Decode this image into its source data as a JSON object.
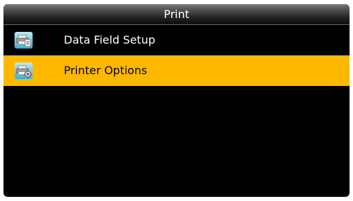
{
  "header": {
    "title": "Print"
  },
  "menu": {
    "items": [
      {
        "label": "Data Field Setup",
        "icon": "printer-document-icon",
        "selected": false
      },
      {
        "label": "Printer Options",
        "icon": "printer-settings-icon",
        "selected": true
      }
    ]
  },
  "colors": {
    "background": "#000000",
    "highlight": "#ffb800",
    "text": "#ffffff",
    "selected_text": "#000000"
  }
}
